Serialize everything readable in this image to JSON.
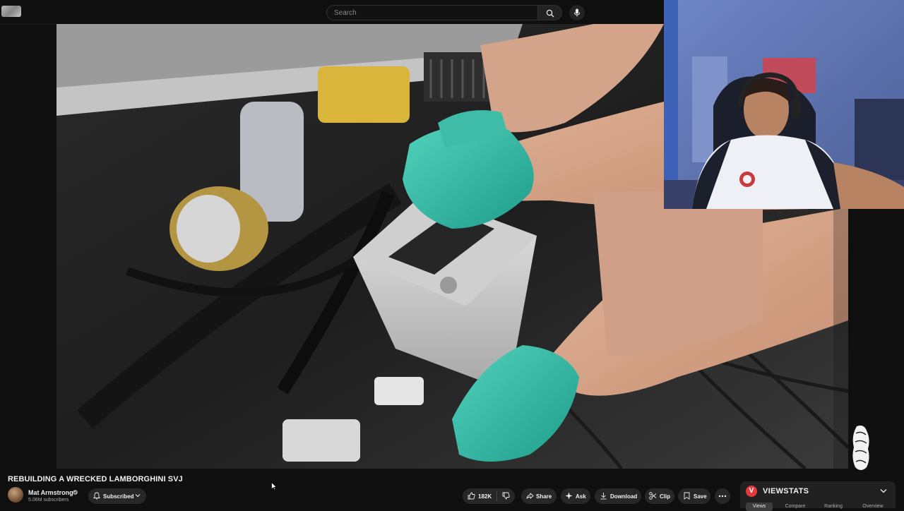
{
  "search": {
    "placeholder": "Search"
  },
  "video": {
    "title": "REBUILDING A WRECKED LAMBORGHINI SVJ",
    "channel": "Mat Armstrong",
    "subscribers": "5.06M subscribers"
  },
  "actions": {
    "subscribe_label": "Subscribed",
    "like_count": "182K",
    "share_label": "Share",
    "ask_label": "Ask",
    "download_label": "Download",
    "clip_label": "Clip",
    "save_label": "Save"
  },
  "viewstats": {
    "logo_letter": "V",
    "title": "VIEWSTATS",
    "tabs": [
      "Views",
      "Compare",
      "Ranking",
      "Overview"
    ]
  },
  "colors": {
    "background": "#0f0f0f",
    "pill": "#272727",
    "accent": "#e03a3a"
  },
  "icons": [
    "search-icon",
    "mic-icon",
    "verified-icon",
    "bell-icon",
    "chevron-down-icon",
    "thumb-up-icon",
    "thumb-down-icon",
    "share-icon",
    "sparkle-icon",
    "download-icon",
    "scissors-icon",
    "save-icon",
    "more-icon"
  ]
}
